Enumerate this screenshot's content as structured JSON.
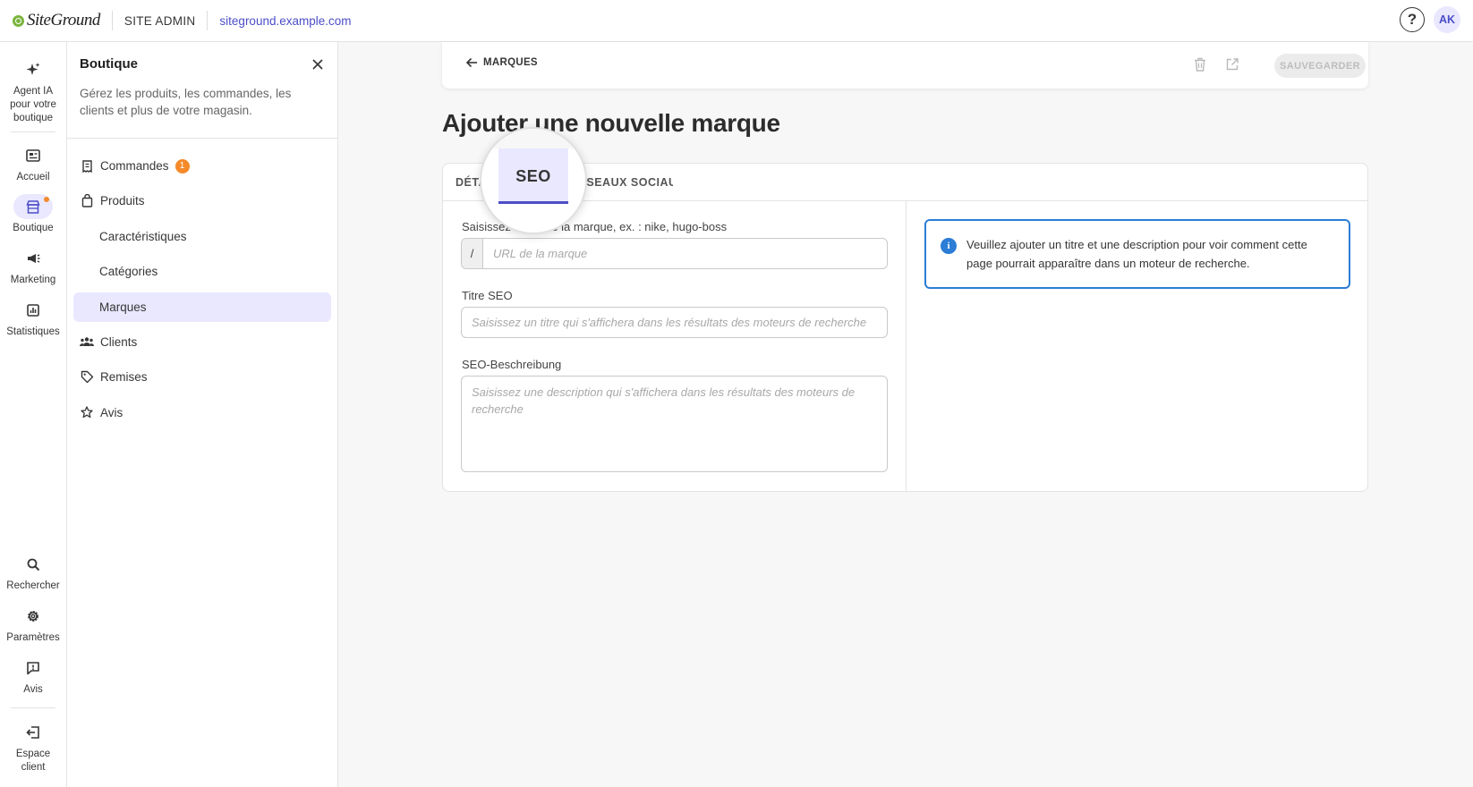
{
  "topbar": {
    "logo_text": "SiteGround",
    "site_admin": "SITE ADMIN",
    "site_url": "siteground.example.com",
    "help_label": "?",
    "avatar_initials": "AK"
  },
  "rail": {
    "ai_agent": "Agent IA pour votre boutique",
    "home": "Accueil",
    "shop": "Boutique",
    "marketing": "Marketing",
    "stats": "Statistiques",
    "search": "Rechercher",
    "settings": "Paramètres",
    "feedback": "Avis",
    "client_area": "Espace client"
  },
  "panel": {
    "title": "Boutique",
    "description": "Gérez les produits, les commandes, les clients et plus de votre magasin.",
    "items": [
      {
        "label": "Commandes",
        "badge": "1"
      },
      {
        "label": "Produits"
      },
      {
        "label": "Caractéristiques"
      },
      {
        "label": "Catégories"
      },
      {
        "label": "Marques"
      },
      {
        "label": "Clients"
      },
      {
        "label": "Remises"
      },
      {
        "label": "Avis"
      }
    ]
  },
  "action_bar": {
    "back_label": "MARQUES",
    "save_label": "SAUVEGARDER"
  },
  "page": {
    "title": "Ajouter une nouvelle marque"
  },
  "tabs": {
    "details": "DÉTAILS",
    "seo": "SEO",
    "social": "RÉSEAUX SOCIAUX"
  },
  "form": {
    "url_label": "Saisissez l'URL de la marque, ex. : nike, hugo-boss",
    "url_prefix": "/",
    "url_placeholder": "URL de la marque",
    "seo_title_label": "Titre SEO",
    "seo_title_placeholder": "Saisissez un titre qui s'affichera dans les résultats des moteurs de recherche",
    "seo_desc_label": "SEO-Beschreibung",
    "seo_desc_placeholder": "Saisissez une description qui s'affichera dans les résultats des moteurs de recherche"
  },
  "info": {
    "text": "Veuillez ajouter un titre et une description pour voir comment cette page pourrait apparaître dans un moteur de recherche."
  },
  "colors": {
    "accent": "#4c4ec7",
    "accent_light": "#e9e8ff",
    "badge": "#f58a2a",
    "info": "#2b7dd6"
  }
}
